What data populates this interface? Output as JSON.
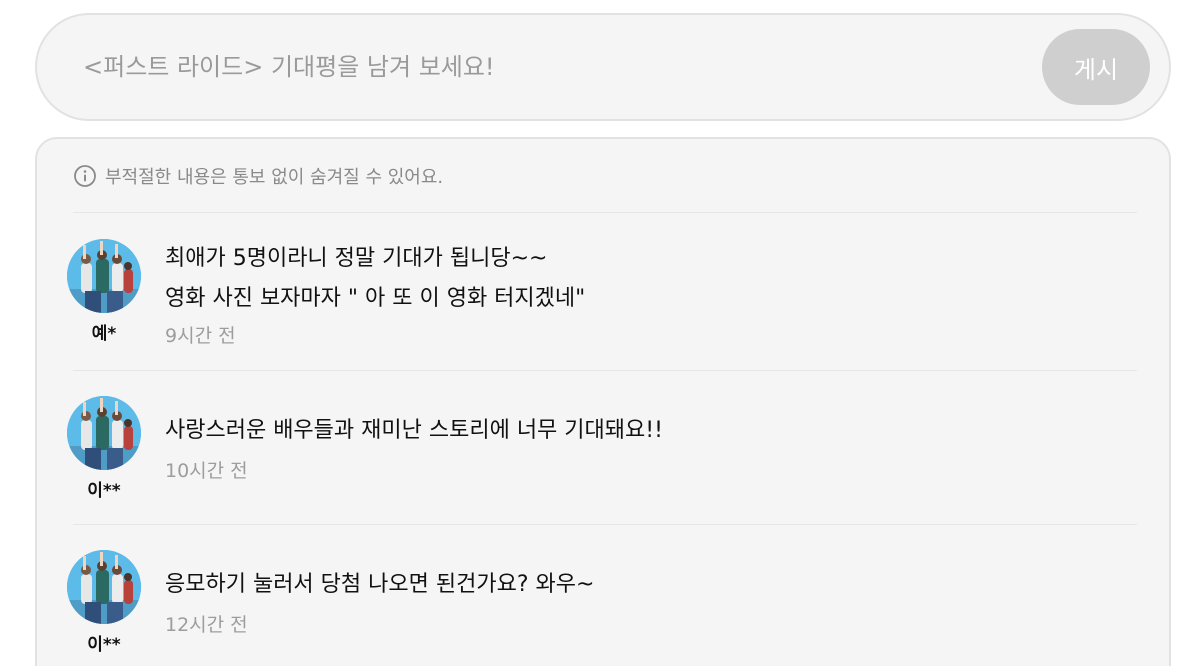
{
  "input": {
    "placeholder": "<퍼스트 라이드> 기대평을 남겨 보세요!",
    "post_label": "게시"
  },
  "notice": {
    "text": "부적절한 내용은 통보 없이 숨겨질 수 있어요.",
    "icon": "info-icon"
  },
  "comments": [
    {
      "author": "예*",
      "text": "최애가 5명이라니 정말 기대가 됩니당~~\n영화 사진 보자마자 \" 아 또 이 영화 터지겠네\"",
      "time": "9시간 전"
    },
    {
      "author": "이**",
      "text": "사랑스러운 배우들과 재미난 스토리에 너무 기대돼요!!",
      "time": "10시간 전"
    },
    {
      "author": "이**",
      "text": "응모하기 눌러서 당첨 나오면 된건가요? 와우~",
      "time": "12시간 전"
    }
  ],
  "colors": {
    "panel_bg": "#f5f5f5",
    "border": "#e2e2e2",
    "button_disabled": "#cfcfcf",
    "muted_text": "#9d9d9d"
  }
}
